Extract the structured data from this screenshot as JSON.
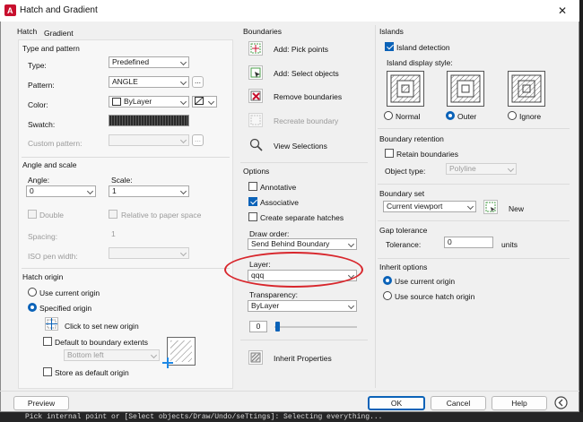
{
  "window": {
    "title": "Hatch and Gradient",
    "close": "✕"
  },
  "tabs": [
    "Hatch",
    "Gradient"
  ],
  "type_pattern": {
    "title": "Type and pattern",
    "type_label": "Type:",
    "type_value": "Predefined",
    "pattern_label": "Pattern:",
    "pattern_value": "ANGLE",
    "pattern_browse": "...",
    "color_label": "Color:",
    "color_value": "ByLayer",
    "swatch_label": "Swatch:",
    "custom_label": "Custom pattern:",
    "custom_browse": "..."
  },
  "angle_scale": {
    "title": "Angle and scale",
    "angle_label": "Angle:",
    "angle_value": "0",
    "scale_label": "Scale:",
    "scale_value": "1",
    "double_label": "Double",
    "relative_label": "Relative to paper space",
    "spacing_label": "Spacing:",
    "spacing_value": "1",
    "iso_label": "ISO pen width:"
  },
  "hatch_origin": {
    "title": "Hatch origin",
    "use_current": "Use current origin",
    "specified": "Specified origin",
    "click_set": "Click to set new origin",
    "default_extents": "Default to boundary extents",
    "extents_value": "Bottom left",
    "store_default": "Store as default origin"
  },
  "boundaries": {
    "title": "Boundaries",
    "add_pick": "Add: Pick points",
    "add_select": "Add: Select objects",
    "remove": "Remove boundaries",
    "recreate": "Recreate boundary",
    "view": "View Selections"
  },
  "options": {
    "title": "Options",
    "annotative": "Annotative",
    "associative": "Associative",
    "separate": "Create separate hatches",
    "draw_order_label": "Draw order:",
    "draw_order_value": "Send Behind Boundary",
    "layer_label": "Layer:",
    "layer_value": "qqq",
    "transparency_label": "Transparency:",
    "transparency_value": "ByLayer",
    "transparency_amount": "0"
  },
  "inherit": {
    "label": "Inherit Properties"
  },
  "islands": {
    "title": "Islands",
    "detection": "Island detection",
    "style_label": "Island display style:",
    "normal": "Normal",
    "outer": "Outer",
    "ignore": "Ignore"
  },
  "retention": {
    "title": "Boundary retention",
    "retain": "Retain boundaries",
    "object_type_label": "Object type:",
    "object_type_value": "Polyline"
  },
  "boundary_set": {
    "title": "Boundary set",
    "value": "Current viewport",
    "new_label": "New"
  },
  "gap": {
    "title": "Gap tolerance",
    "tolerance_label": "Tolerance:",
    "tolerance_value": "0",
    "units": "units"
  },
  "inherit_options": {
    "title": "Inherit options",
    "current": "Use current origin",
    "source": "Use source hatch origin"
  },
  "footer": {
    "preview": "Preview",
    "ok": "OK",
    "cancel": "Cancel",
    "help": "Help"
  },
  "command_line": "Pick internal point or [Select objects/Draw/Undo/seTtings]: Selecting everything...",
  "colors": {
    "accent": "#0a62b8",
    "annotation": "#d8262c"
  }
}
